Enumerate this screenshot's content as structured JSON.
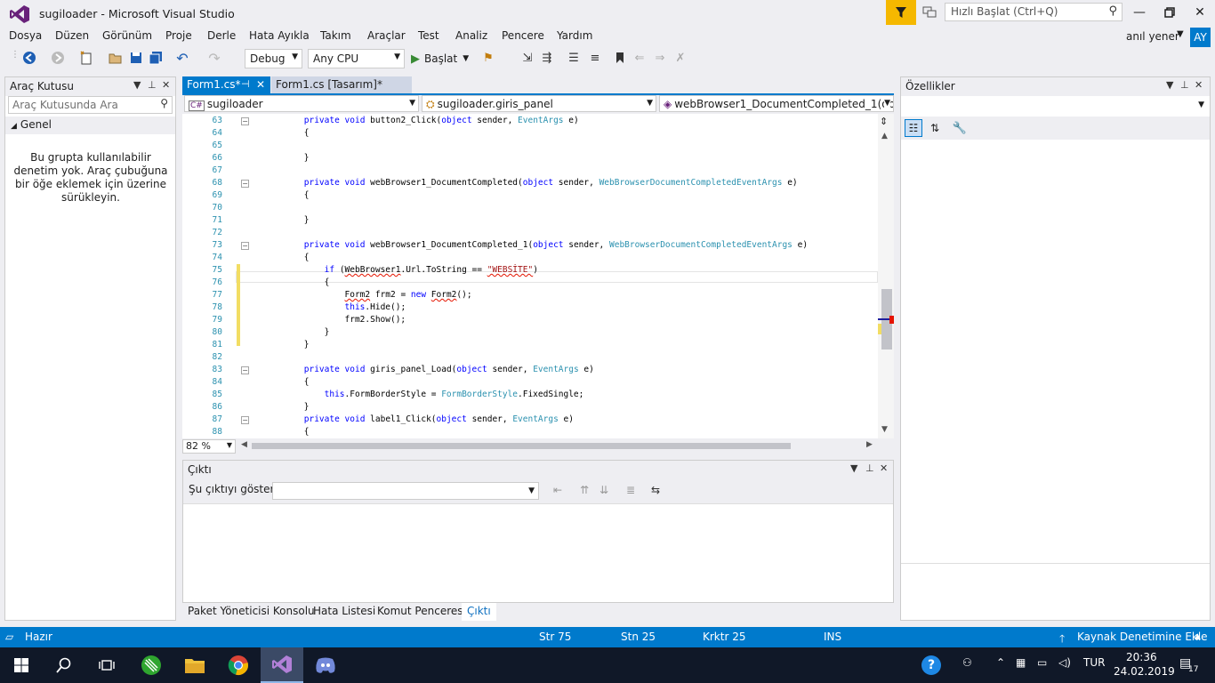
{
  "window": {
    "title": "sugiloader - Microsoft Visual Studio",
    "quick_launch_placeholder": "Hızlı Başlat (Ctrl+Q)",
    "user_name": "anıl yener",
    "user_initials": "AY"
  },
  "menu": [
    "Dosya",
    "Düzen",
    "Görünüm",
    "Proje",
    "Derle",
    "Hata Ayıkla",
    "Takım",
    "Araçlar",
    "Test",
    "Analiz",
    "Pencere",
    "Yardım"
  ],
  "toolbar": {
    "configuration": "Debug",
    "platform": "Any CPU",
    "start_label": "Başlat"
  },
  "toolbox": {
    "title": "Araç Kutusu",
    "search_placeholder": "Araç Kutusunda Ara",
    "group": "Genel",
    "empty_message": "Bu grupta kullanılabilir denetim yok. Araç çubuğuna bir öğe eklemek için üzerine sürükleyin."
  },
  "tabs": [
    {
      "label": "Form1.cs*"
    },
    {
      "label": "Form1.cs [Tasarım]*"
    }
  ],
  "navbar": {
    "project": "sugiloader",
    "class": "sugiloader.giris_panel",
    "member": "webBrowser1_DocumentCompleted_1(obje"
  },
  "editor": {
    "zoom": "82 %",
    "lines": [
      {
        "n": "63",
        "html": "        <span class='kw'>private</span> <span class='kw'>void</span> button2_Click(<span class='kw'>object</span> sender, <span class='ty'>EventArgs</span> e)"
      },
      {
        "n": "64",
        "html": "        {"
      },
      {
        "n": "65",
        "html": ""
      },
      {
        "n": "66",
        "html": "        }"
      },
      {
        "n": "67",
        "html": ""
      },
      {
        "n": "68",
        "html": "        <span class='kw'>private</span> <span class='kw'>void</span> webBrowser1_DocumentCompleted(<span class='kw'>object</span> sender, <span class='ty'>WebBrowserDocumentCompletedEventArgs</span> e)"
      },
      {
        "n": "69",
        "html": "        {"
      },
      {
        "n": "70",
        "html": ""
      },
      {
        "n": "71",
        "html": "        }"
      },
      {
        "n": "72",
        "html": ""
      },
      {
        "n": "73",
        "html": "        <span class='kw'>private</span> <span class='kw'>void</span> webBrowser1_DocumentCompleted_1(<span class='kw'>object</span> sender, <span class='ty'>WebBrowserDocumentCompletedEventArgs</span> e)"
      },
      {
        "n": "74",
        "html": "        {"
      },
      {
        "n": "75",
        "html": "            <span class='kw'>if</span> (<span class='squig'>WebBrowser1</span>.Url.ToString == <span class='st squig'>\"WEBSİTE\"</span>)"
      },
      {
        "n": "76",
        "html": "            {"
      },
      {
        "n": "77",
        "html": "                <span class='squig'>Form2</span> frm2 = <span class='kw'>new</span> <span class='squig'>Form2</span>();"
      },
      {
        "n": "78",
        "html": "                <span class='kw'>this</span>.Hide();"
      },
      {
        "n": "79",
        "html": "                frm2.Show();"
      },
      {
        "n": "80",
        "html": "            }"
      },
      {
        "n": "81",
        "html": "        }"
      },
      {
        "n": "82",
        "html": ""
      },
      {
        "n": "83",
        "html": "        <span class='kw'>private</span> <span class='kw'>void</span> giris_panel_Load(<span class='kw'>object</span> sender, <span class='ty'>EventArgs</span> e)"
      },
      {
        "n": "84",
        "html": "        {"
      },
      {
        "n": "85",
        "html": "            <span class='kw'>this</span>.FormBorderStyle = <span class='ty'>FormBorderStyle</span>.FixedSingle;"
      },
      {
        "n": "86",
        "html": "        }"
      },
      {
        "n": "87",
        "html": "        <span class='kw'>private</span> <span class='kw'>void</span> label1_Click(<span class='kw'>object</span> sender, <span class='ty'>EventArgs</span> e)"
      },
      {
        "n": "88",
        "html": "        {"
      }
    ]
  },
  "output": {
    "title": "Çıktı",
    "source_label": "Şu çıktıyı göster:",
    "source_value": ""
  },
  "bottom_tabs": [
    "Paket Yöneticisi Konsolu",
    "Hata Listesi",
    "Komut Penceresi",
    "Çıktı"
  ],
  "properties": {
    "title": "Özellikler"
  },
  "status": {
    "state": "Hazır",
    "line": "Str 75",
    "col": "Stn 25",
    "char": "Krktr 25",
    "mode": "INS",
    "source_control": "Kaynak Denetimine Ekle"
  },
  "taskbar": {
    "language": "TUR",
    "time": "20:36",
    "date": "24.02.2019",
    "notification_count": "17"
  },
  "colors": {
    "accent": "#007acc",
    "filter": "#f5b800",
    "taskbar": "#101828"
  }
}
